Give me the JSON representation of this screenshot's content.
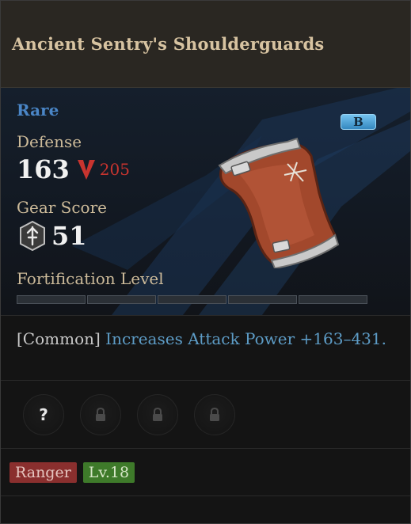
{
  "item": {
    "name": "Ancient Sentry's Shoulderguards",
    "grade": "Rare",
    "badge": "B",
    "defense": {
      "label": "Defense",
      "value": "163",
      "compare_value": "205",
      "compare_icon": "down-arrow-icon"
    },
    "gear_score": {
      "label": "Gear Score",
      "value": "51",
      "icon": "gear-score-icon"
    },
    "fortification": {
      "label": "Fortification Level",
      "segments_filled": 0,
      "segments_total": 5
    },
    "effect": {
      "tier": "[Common]",
      "text": "Increases Attack Power +163–431."
    },
    "slots": [
      {
        "icon": "question-icon",
        "label": "?"
      },
      {
        "icon": "lock-icon"
      },
      {
        "icon": "lock-icon"
      },
      {
        "icon": "lock-icon"
      }
    ],
    "tags": {
      "class": "Ranger",
      "level": "Lv.18"
    }
  },
  "colors": {
    "grade_rare": "#4a86c7",
    "compare_down": "#c8342f",
    "class_tag": "#8a2f2e",
    "level_tag": "#3e7a2a"
  }
}
